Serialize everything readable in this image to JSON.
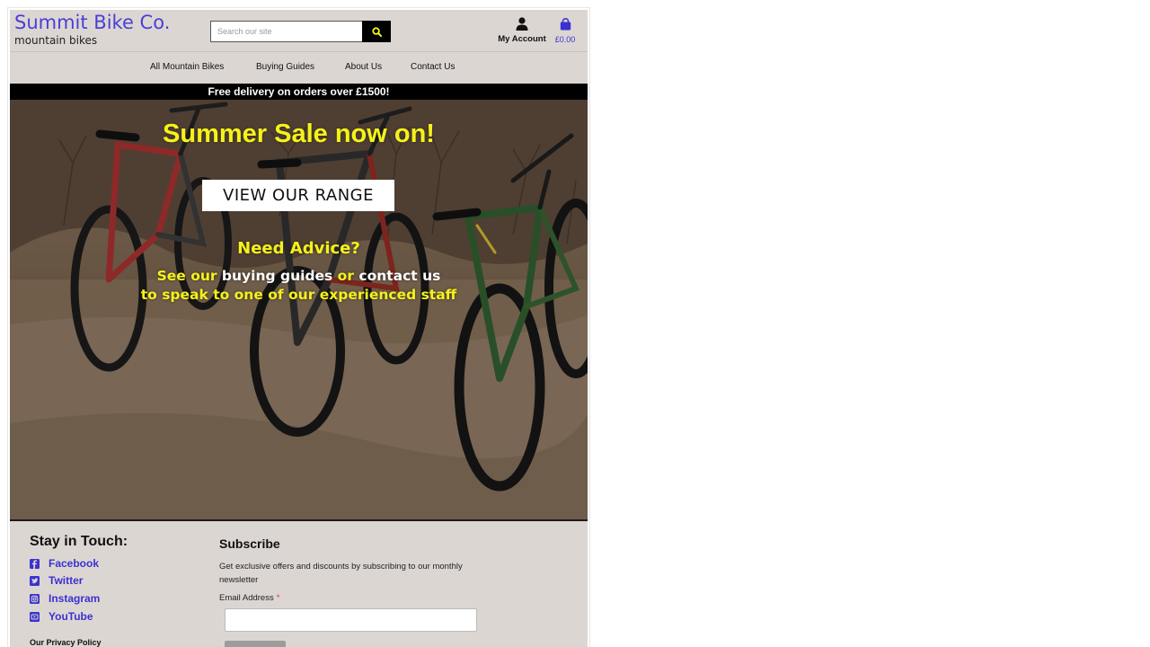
{
  "brand": {
    "name": "Summit Bike Co.",
    "tagline": "mountain bikes"
  },
  "search": {
    "placeholder": "Search our site",
    "value": ""
  },
  "account": {
    "label": "My Account"
  },
  "cart": {
    "total": "£0.00"
  },
  "nav": {
    "items": [
      {
        "label": "All Mountain Bikes"
      },
      {
        "label": "Buying Guides"
      },
      {
        "label": "About Us"
      },
      {
        "label": "Contact Us"
      }
    ]
  },
  "banner": {
    "text": "Free delivery on orders over £1500!"
  },
  "hero": {
    "title": "Summer Sale now on!",
    "cta_label": "VIEW OUR RANGE",
    "advice_title": "Need Advice?",
    "advice_line1": {
      "a": "See our ",
      "b": "buying guides",
      "c": " or ",
      "d": "contact us"
    },
    "advice_line2": "to speak to one of our experienced staff"
  },
  "footer": {
    "stay_heading": "Stay in Touch:",
    "social": [
      {
        "label": "Facebook",
        "icon": "facebook-icon"
      },
      {
        "label": "Twitter",
        "icon": "twitter-icon"
      },
      {
        "label": "Instagram",
        "icon": "instagram-icon"
      },
      {
        "label": "YouTube",
        "icon": "youtube-icon"
      }
    ],
    "privacy_label": "Our Privacy Policy",
    "subscribe_heading": "Subscribe",
    "subscribe_text": "Get exclusive offers and discounts by subscribing to our monthly newsletter",
    "email_label": "Email Address",
    "required_mark": "*",
    "email_value": ""
  },
  "colors": {
    "brand": "#4a3fd6",
    "link": "#3a32d0",
    "hero_highlight": "#f5f21a",
    "page_background": "#dcd6d3",
    "banner_background": "#000000"
  }
}
